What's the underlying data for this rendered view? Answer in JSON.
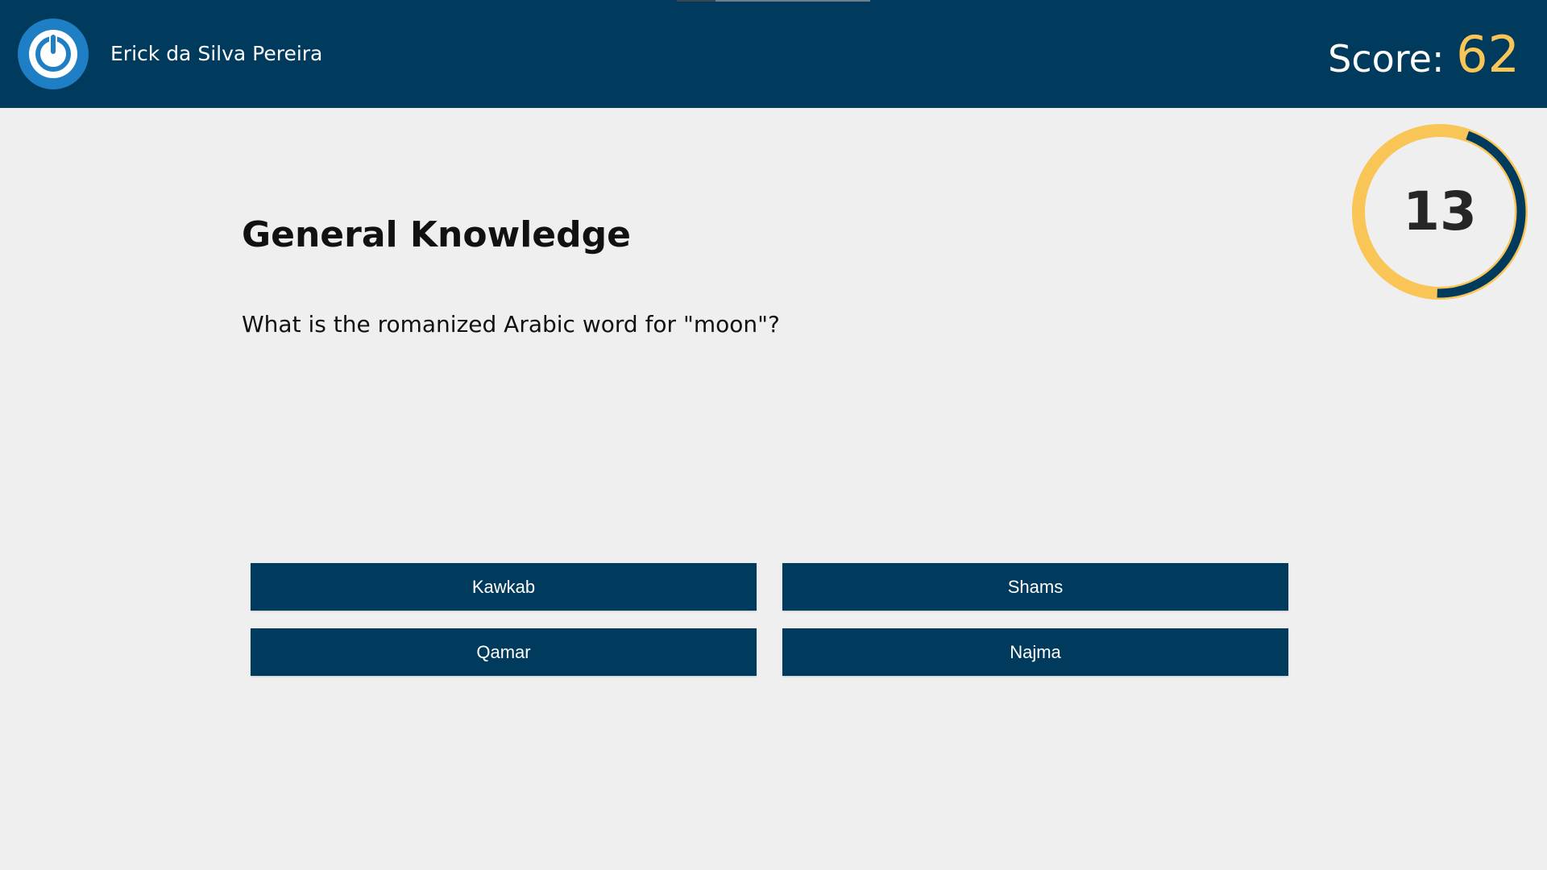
{
  "header": {
    "user_name": "Erick da Silva Pereira",
    "score_label": "Score:",
    "score_value": "62",
    "power_icon": "power-icon"
  },
  "timer": {
    "seconds_left": "13",
    "remaining_fraction": 0.45,
    "colors": {
      "remaining": "#003a5c",
      "elapsed": "#f9c557"
    }
  },
  "quiz": {
    "category": "General Knowledge",
    "question": "What is the romanized Arabic word for \"moon\"?",
    "answers": [
      "Kawkab",
      "Shams",
      "Qamar",
      "Najma"
    ]
  },
  "colors": {
    "header_bg": "#003a5c",
    "page_bg": "#efefef",
    "accent": "#f9c557",
    "button_bg": "#003a5c",
    "power_button": "#1e7fc4"
  }
}
